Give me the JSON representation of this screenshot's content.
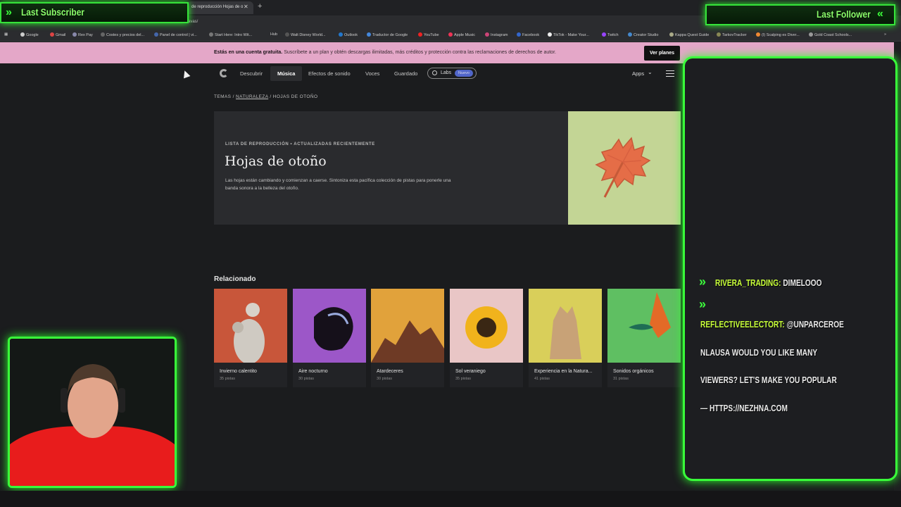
{
  "browser": {
    "tab_title": "de reproducción Hojas de o",
    "url": "ravas/",
    "bookmarks": [
      "Google",
      "Gmail",
      "Rex Pay",
      "Costes y precios del...",
      "Panel de control | vi...",
      "Start Here: Intro Wit...",
      "Hub",
      "Walt Disney World...",
      "Outlook",
      "Traductor de Google",
      "YouTube",
      "Apple Music",
      "Instagram",
      "Facebook",
      "TikTok - Make Your...",
      "Twitch",
      "Creator Studio",
      "Kappa Quest Guide",
      "TarkovTracker",
      "(I) Scalping es Diver...",
      "Gold Coast Schools..."
    ]
  },
  "banner": {
    "bold": "Estás en una cuenta gratuita.",
    "text": "Suscríbete a un plan y obtén descargas ilimitadas, más créditos y protección contra las reclamaciones de derechos de autor.",
    "button": "Ver planes"
  },
  "nav": {
    "items": [
      "Descubrir",
      "Música",
      "Efectos de sonido",
      "Voces",
      "Guardado"
    ],
    "labs": "Labs",
    "labs_badge": "Nuevo",
    "apps": "Apps"
  },
  "breadcrumb": {
    "part1": "TEMAS / ",
    "part2": "NATURALEZA",
    "part3": " / HOJAS DE OTOÑO"
  },
  "hero": {
    "eyebrow": "LISTA DE REPRODUCCIÓN • ACTUALIZADAS RECIENTEMENTE",
    "title": "Hojas de otoño",
    "description": "Las hojas están cambiando y comienzan a caerse. Sintoniza esta pacífica colección de pistas para ponerle una banda sonora a la belleza del otoño."
  },
  "related": {
    "title": "Relacionado",
    "cards": [
      {
        "title": "Invierno calentito",
        "count": "35 pistas",
        "color": "#c8563a"
      },
      {
        "title": "Aire nocturno",
        "count": "30 pistas",
        "color": "#9c57c8"
      },
      {
        "title": "Atardeceres",
        "count": "30 pistas",
        "color": "#e1a23b"
      },
      {
        "title": "Sol veraniego",
        "count": "35 pistas",
        "color": "#e9c6c6"
      },
      {
        "title": "Experiencia en la Natura...",
        "count": "41 pistas",
        "color": "#d9cf5a"
      },
      {
        "title": "Sonidos orgánicos",
        "count": "31 pistas",
        "color": "#5fbf62"
      }
    ]
  },
  "overlay": {
    "last_subscriber": "Last Subscriber",
    "last_follower": "Last Follower"
  },
  "chat": [
    {
      "user": "RIVERA_TRADING:",
      "text": "DIMELOOO"
    },
    {
      "user": "",
      "text": ""
    },
    {
      "user": "REFLECTIVEELECTORT:",
      "text": "@UNPARCEROE"
    },
    {
      "user": "",
      "text": "NLAUSA WOULD YOU LIKE MANY"
    },
    {
      "user": "",
      "text": "VIEWERS? LET'S MAKE YOU POPULAR"
    },
    {
      "user": "",
      "text": "— HTTPS://NEZHNA.COM"
    }
  ]
}
